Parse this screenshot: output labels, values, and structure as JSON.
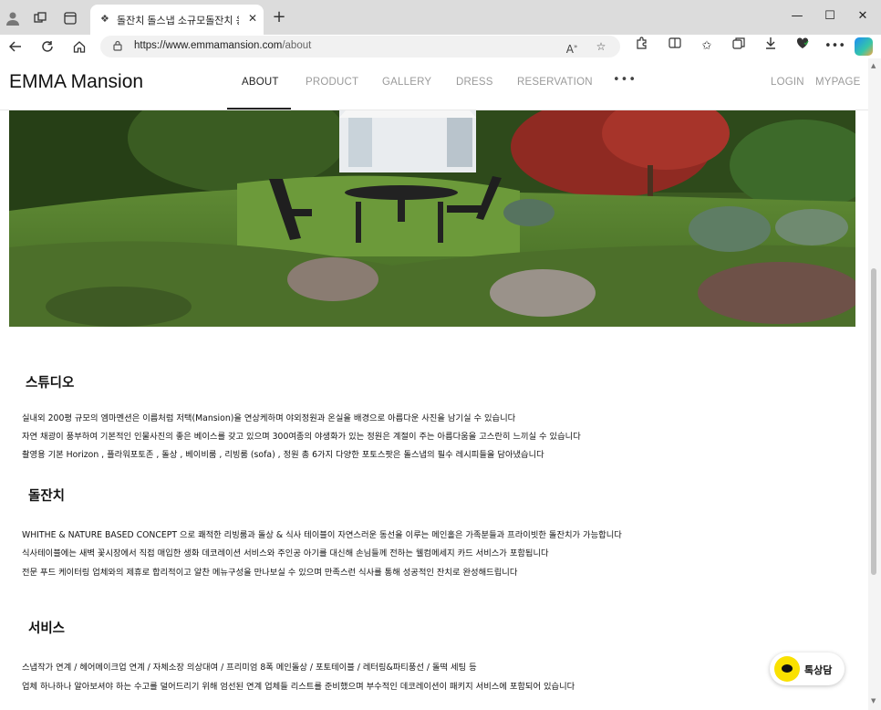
{
  "browser": {
    "tab_title": "돌잔치 돌스냅 소규모돌잔치 응접",
    "url_host": "https://www.emmamansion.com",
    "url_path": "/about"
  },
  "site": {
    "logo": "EMMA Mansion",
    "menu": [
      "ABOUT",
      "PRODUCT",
      "GALLERY",
      "DRESS",
      "RESERVATION"
    ],
    "more": "•••",
    "login": "LOGIN",
    "mypage": "MYPAGE"
  },
  "sections": [
    {
      "title": "스튜디오",
      "lines": [
        "실내외 200평 규모의 엠마멘션은 이름처럼 저택(Mansion)을 연상케하며 야외정원과 온실을 배경으로 아름다운 사진을 남기실 수 있습니다",
        "자연 채광이 풍부하여 기본적인 인물사진의 좋은 베이스를 갖고 있으며 300여종의 야생화가 있는 정원은 계절이 주는 아름다움을 고스란히 느끼실 수 있습니다",
        "촬영용 기본 Horizon , 플라워포토존 , 돌상 , 베이비룸 , 리빙룸 (sofa) , 정원 총 6가지 다양한 포토스팟은 돌스냅의 필수 레시피들을 담아냈습니다"
      ]
    },
    {
      "title": "돌잔치",
      "lines": [
        "WHITHE & NATURE BASED CONCEPT 으로 쾌적한 리빙룸과 돌상 & 식사 테이블이 자연스러운 동선을 이루는 메인홀은 가족분들과 프라이빗한 돌잔치가 가능합니다",
        "식사테이블에는 새벽 꽃시장에서 직접 매입한 생화 데코레이션 서비스와 주인공 아기를 대신해 손님들께 전하는 웰컴메세지 카드 서비스가 포함됩니다",
        "전문 푸드 케이터링 업체와의 제휴로 합리적이고 알찬 메뉴구성을 만나보실 수 있으며 만족스런 식사를 통해 성공적인 잔치로 완성해드립니다"
      ]
    },
    {
      "title": "서비스",
      "lines": [
        "스냅작가 연계 / 헤어메이크업 연계 / 자체소장 의상대여 / 프리미엄 8폭 메인돌상 / 포토테이블 /  레터링&파티풍선 / 돌떡 세팅 등",
        "업체 하나하나 알아보셔야 하는 수고를 덜어드리기 위해 엄선된 연계 업체들 리스트를 준비했으며 부수적인 데코레이션이 패키지 서비스에 포함되어 있습니다"
      ]
    }
  ],
  "kakao": {
    "label": "톡상담",
    "color": "#fae100"
  },
  "icons": {
    "profile": "profile-icon",
    "workspaces": "workspaces-icon",
    "tab_actions": "tab-actions-icon",
    "back": "back-icon",
    "refresh": "refresh-icon",
    "home": "home-icon",
    "lock": "lock-icon",
    "read_aloud": "read-aloud-icon",
    "favorite": "star-icon",
    "extensions": "extensions-icon",
    "split": "split-screen-icon",
    "favorites": "favorites-icon",
    "collections": "collections-icon",
    "downloads": "download-icon",
    "browser_essentials": "heart-shield-icon",
    "settings": "more-icon",
    "copilot": "copilot-icon"
  }
}
